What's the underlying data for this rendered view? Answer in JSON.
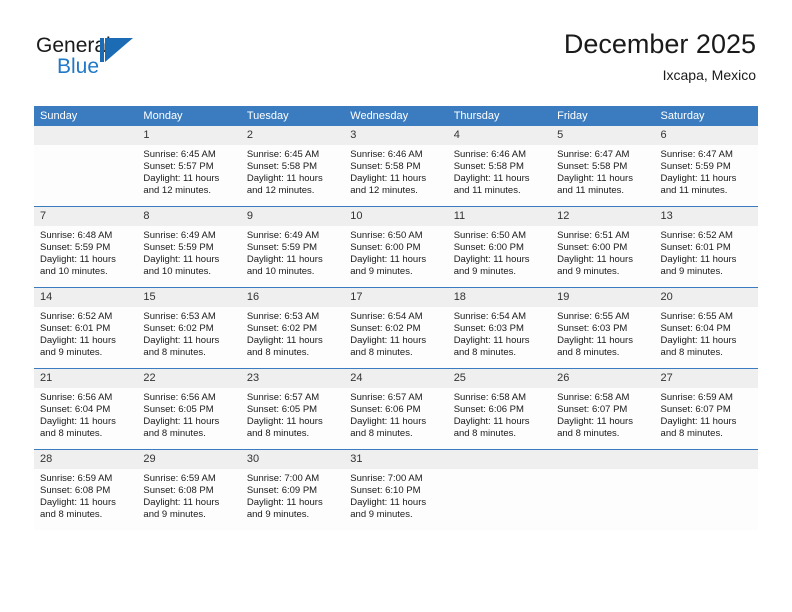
{
  "brand": {
    "name_part1": "General",
    "name_part2": "Blue",
    "mark": "triangle-logo"
  },
  "header": {
    "title": "December 2025",
    "subtitle": "Ixcapa, Mexico"
  },
  "calendar": {
    "weekday_headers": [
      "Sunday",
      "Monday",
      "Tuesday",
      "Wednesday",
      "Thursday",
      "Friday",
      "Saturday"
    ],
    "accent_color": "#3b7cc0",
    "daynum_band_color": "#efefef",
    "weeks": [
      [
        {
          "day": "",
          "sunrise": "",
          "sunset": "",
          "daylight_line1": "",
          "daylight_line2": "",
          "blank": true
        },
        {
          "day": "1",
          "sunrise": "Sunrise: 6:45 AM",
          "sunset": "Sunset: 5:57 PM",
          "daylight_line1": "Daylight: 11 hours",
          "daylight_line2": "and 12 minutes.",
          "blank": false
        },
        {
          "day": "2",
          "sunrise": "Sunrise: 6:45 AM",
          "sunset": "Sunset: 5:58 PM",
          "daylight_line1": "Daylight: 11 hours",
          "daylight_line2": "and 12 minutes.",
          "blank": false
        },
        {
          "day": "3",
          "sunrise": "Sunrise: 6:46 AM",
          "sunset": "Sunset: 5:58 PM",
          "daylight_line1": "Daylight: 11 hours",
          "daylight_line2": "and 12 minutes.",
          "blank": false
        },
        {
          "day": "4",
          "sunrise": "Sunrise: 6:46 AM",
          "sunset": "Sunset: 5:58 PM",
          "daylight_line1": "Daylight: 11 hours",
          "daylight_line2": "and 11 minutes.",
          "blank": false
        },
        {
          "day": "5",
          "sunrise": "Sunrise: 6:47 AM",
          "sunset": "Sunset: 5:58 PM",
          "daylight_line1": "Daylight: 11 hours",
          "daylight_line2": "and 11 minutes.",
          "blank": false
        },
        {
          "day": "6",
          "sunrise": "Sunrise: 6:47 AM",
          "sunset": "Sunset: 5:59 PM",
          "daylight_line1": "Daylight: 11 hours",
          "daylight_line2": "and 11 minutes.",
          "blank": false
        }
      ],
      [
        {
          "day": "7",
          "sunrise": "Sunrise: 6:48 AM",
          "sunset": "Sunset: 5:59 PM",
          "daylight_line1": "Daylight: 11 hours",
          "daylight_line2": "and 10 minutes.",
          "blank": false
        },
        {
          "day": "8",
          "sunrise": "Sunrise: 6:49 AM",
          "sunset": "Sunset: 5:59 PM",
          "daylight_line1": "Daylight: 11 hours",
          "daylight_line2": "and 10 minutes.",
          "blank": false
        },
        {
          "day": "9",
          "sunrise": "Sunrise: 6:49 AM",
          "sunset": "Sunset: 5:59 PM",
          "daylight_line1": "Daylight: 11 hours",
          "daylight_line2": "and 10 minutes.",
          "blank": false
        },
        {
          "day": "10",
          "sunrise": "Sunrise: 6:50 AM",
          "sunset": "Sunset: 6:00 PM",
          "daylight_line1": "Daylight: 11 hours",
          "daylight_line2": "and 9 minutes.",
          "blank": false
        },
        {
          "day": "11",
          "sunrise": "Sunrise: 6:50 AM",
          "sunset": "Sunset: 6:00 PM",
          "daylight_line1": "Daylight: 11 hours",
          "daylight_line2": "and 9 minutes.",
          "blank": false
        },
        {
          "day": "12",
          "sunrise": "Sunrise: 6:51 AM",
          "sunset": "Sunset: 6:00 PM",
          "daylight_line1": "Daylight: 11 hours",
          "daylight_line2": "and 9 minutes.",
          "blank": false
        },
        {
          "day": "13",
          "sunrise": "Sunrise: 6:52 AM",
          "sunset": "Sunset: 6:01 PM",
          "daylight_line1": "Daylight: 11 hours",
          "daylight_line2": "and 9 minutes.",
          "blank": false
        }
      ],
      [
        {
          "day": "14",
          "sunrise": "Sunrise: 6:52 AM",
          "sunset": "Sunset: 6:01 PM",
          "daylight_line1": "Daylight: 11 hours",
          "daylight_line2": "and 9 minutes.",
          "blank": false
        },
        {
          "day": "15",
          "sunrise": "Sunrise: 6:53 AM",
          "sunset": "Sunset: 6:02 PM",
          "daylight_line1": "Daylight: 11 hours",
          "daylight_line2": "and 8 minutes.",
          "blank": false
        },
        {
          "day": "16",
          "sunrise": "Sunrise: 6:53 AM",
          "sunset": "Sunset: 6:02 PM",
          "daylight_line1": "Daylight: 11 hours",
          "daylight_line2": "and 8 minutes.",
          "blank": false
        },
        {
          "day": "17",
          "sunrise": "Sunrise: 6:54 AM",
          "sunset": "Sunset: 6:02 PM",
          "daylight_line1": "Daylight: 11 hours",
          "daylight_line2": "and 8 minutes.",
          "blank": false
        },
        {
          "day": "18",
          "sunrise": "Sunrise: 6:54 AM",
          "sunset": "Sunset: 6:03 PM",
          "daylight_line1": "Daylight: 11 hours",
          "daylight_line2": "and 8 minutes.",
          "blank": false
        },
        {
          "day": "19",
          "sunrise": "Sunrise: 6:55 AM",
          "sunset": "Sunset: 6:03 PM",
          "daylight_line1": "Daylight: 11 hours",
          "daylight_line2": "and 8 minutes.",
          "blank": false
        },
        {
          "day": "20",
          "sunrise": "Sunrise: 6:55 AM",
          "sunset": "Sunset: 6:04 PM",
          "daylight_line1": "Daylight: 11 hours",
          "daylight_line2": "and 8 minutes.",
          "blank": false
        }
      ],
      [
        {
          "day": "21",
          "sunrise": "Sunrise: 6:56 AM",
          "sunset": "Sunset: 6:04 PM",
          "daylight_line1": "Daylight: 11 hours",
          "daylight_line2": "and 8 minutes.",
          "blank": false
        },
        {
          "day": "22",
          "sunrise": "Sunrise: 6:56 AM",
          "sunset": "Sunset: 6:05 PM",
          "daylight_line1": "Daylight: 11 hours",
          "daylight_line2": "and 8 minutes.",
          "blank": false
        },
        {
          "day": "23",
          "sunrise": "Sunrise: 6:57 AM",
          "sunset": "Sunset: 6:05 PM",
          "daylight_line1": "Daylight: 11 hours",
          "daylight_line2": "and 8 minutes.",
          "blank": false
        },
        {
          "day": "24",
          "sunrise": "Sunrise: 6:57 AM",
          "sunset": "Sunset: 6:06 PM",
          "daylight_line1": "Daylight: 11 hours",
          "daylight_line2": "and 8 minutes.",
          "blank": false
        },
        {
          "day": "25",
          "sunrise": "Sunrise: 6:58 AM",
          "sunset": "Sunset: 6:06 PM",
          "daylight_line1": "Daylight: 11 hours",
          "daylight_line2": "and 8 minutes.",
          "blank": false
        },
        {
          "day": "26",
          "sunrise": "Sunrise: 6:58 AM",
          "sunset": "Sunset: 6:07 PM",
          "daylight_line1": "Daylight: 11 hours",
          "daylight_line2": "and 8 minutes.",
          "blank": false
        },
        {
          "day": "27",
          "sunrise": "Sunrise: 6:59 AM",
          "sunset": "Sunset: 6:07 PM",
          "daylight_line1": "Daylight: 11 hours",
          "daylight_line2": "and 8 minutes.",
          "blank": false
        }
      ],
      [
        {
          "day": "28",
          "sunrise": "Sunrise: 6:59 AM",
          "sunset": "Sunset: 6:08 PM",
          "daylight_line1": "Daylight: 11 hours",
          "daylight_line2": "and 8 minutes.",
          "blank": false
        },
        {
          "day": "29",
          "sunrise": "Sunrise: 6:59 AM",
          "sunset": "Sunset: 6:08 PM",
          "daylight_line1": "Daylight: 11 hours",
          "daylight_line2": "and 9 minutes.",
          "blank": false
        },
        {
          "day": "30",
          "sunrise": "Sunrise: 7:00 AM",
          "sunset": "Sunset: 6:09 PM",
          "daylight_line1": "Daylight: 11 hours",
          "daylight_line2": "and 9 minutes.",
          "blank": false
        },
        {
          "day": "31",
          "sunrise": "Sunrise: 7:00 AM",
          "sunset": "Sunset: 6:10 PM",
          "daylight_line1": "Daylight: 11 hours",
          "daylight_line2": "and 9 minutes.",
          "blank": false
        },
        {
          "day": "",
          "sunrise": "",
          "sunset": "",
          "daylight_line1": "",
          "daylight_line2": "",
          "blank": true
        },
        {
          "day": "",
          "sunrise": "",
          "sunset": "",
          "daylight_line1": "",
          "daylight_line2": "",
          "blank": true
        },
        {
          "day": "",
          "sunrise": "",
          "sunset": "",
          "daylight_line1": "",
          "daylight_line2": "",
          "blank": true
        }
      ]
    ]
  }
}
